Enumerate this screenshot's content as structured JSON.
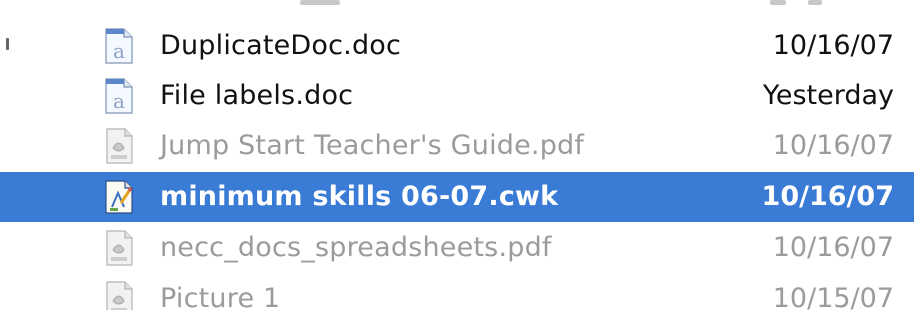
{
  "files": [
    {
      "name": "DuplicateDoc.doc",
      "date": "10/16/07",
      "kind": "word-doc-icon",
      "state": "normal"
    },
    {
      "name": "File labels.doc",
      "date": "Yesterday",
      "kind": "word-doc-icon",
      "state": "normal"
    },
    {
      "name": "Jump Start Teacher's Guide.pdf",
      "date": "10/16/07",
      "kind": "pdf-icon",
      "state": "dim"
    },
    {
      "name": "minimum skills 06-07.cwk",
      "date": "10/16/07",
      "kind": "appleworks-icon",
      "state": "selected"
    },
    {
      "name": "necc_docs_spreadsheets.pdf",
      "date": "10/16/07",
      "kind": "pdf-icon",
      "state": "dim"
    },
    {
      "name": "Picture 1",
      "date": "10/15/07",
      "kind": "pdf-icon",
      "state": "dim"
    }
  ],
  "colors": {
    "selection": "#3a7bd5",
    "text": "#111111",
    "dim_text": "#9b9b9b",
    "selected_text": "#ffffff"
  }
}
